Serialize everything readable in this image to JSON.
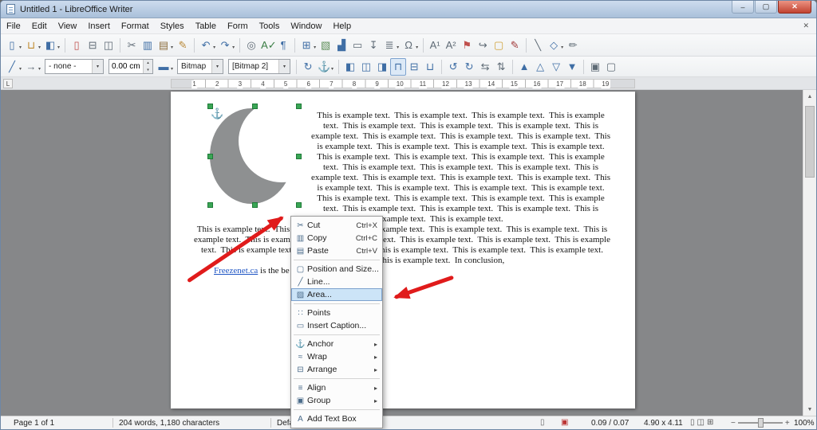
{
  "window": {
    "title": "Untitled 1 - LibreOffice Writer",
    "buttons": [
      {
        "n": "minimize-button",
        "g": "–",
        "cls": "wbtn"
      },
      {
        "n": "maximize-button",
        "g": "▢",
        "cls": "wbtn"
      },
      {
        "n": "close-button",
        "g": "✕",
        "cls": "wbtn close"
      }
    ]
  },
  "menubar": {
    "items": [
      {
        "n": "menu-file",
        "l": "File"
      },
      {
        "n": "menu-edit",
        "l": "Edit"
      },
      {
        "n": "menu-view",
        "l": "View"
      },
      {
        "n": "menu-insert",
        "l": "Insert"
      },
      {
        "n": "menu-format",
        "l": "Format"
      },
      {
        "n": "menu-styles",
        "l": "Styles"
      },
      {
        "n": "menu-table",
        "l": "Table"
      },
      {
        "n": "menu-form",
        "l": "Form"
      },
      {
        "n": "menu-tools",
        "l": "Tools"
      },
      {
        "n": "menu-window",
        "l": "Window"
      },
      {
        "n": "menu-help",
        "l": "Help"
      }
    ],
    "close_glyph": "✕"
  },
  "toolbar_main": {
    "items": [
      {
        "n": "new-document-button",
        "ic": "new-document-icon",
        "g": "▯",
        "c": "#3f6ea5",
        "dd": true
      },
      {
        "n": "open-button",
        "ic": "open-folder-icon",
        "g": "⊔",
        "c": "#c08a2e",
        "dd": true
      },
      {
        "n": "save-button",
        "ic": "save-icon",
        "g": "◧",
        "c": "#3f6ea5",
        "dd": true
      },
      {
        "sep": true
      },
      {
        "n": "export-pdf-button",
        "ic": "pdf-icon",
        "g": "▯",
        "c": "#c0504d"
      },
      {
        "n": "print-button",
        "ic": "printer-icon",
        "g": "⊟",
        "c": "#5f6b76"
      },
      {
        "n": "print-preview-button",
        "ic": "print-preview-icon",
        "g": "◫",
        "c": "#5f6b76"
      },
      {
        "sep": true
      },
      {
        "n": "cut-button",
        "ic": "cut-icon",
        "g": "✂",
        "c": "#5f6b76"
      },
      {
        "n": "copy-button",
        "ic": "copy-icon",
        "g": "▥",
        "c": "#3f6ea5"
      },
      {
        "n": "paste-button",
        "ic": "paste-icon",
        "g": "▤",
        "c": "#8d6e3f",
        "dd": true
      },
      {
        "n": "clone-formatting-button",
        "ic": "clone-formatting-icon",
        "g": "✎",
        "c": "#b98a3a"
      },
      {
        "sep": true
      },
      {
        "n": "undo-button",
        "ic": "undo-icon",
        "g": "↶",
        "c": "#3f6ea5",
        "dd": true
      },
      {
        "n": "redo-button",
        "ic": "redo-icon",
        "g": "↷",
        "c": "#3f6ea5",
        "dd": true
      },
      {
        "sep": true
      },
      {
        "n": "find-replace-button",
        "ic": "find-replace-icon",
        "g": "◎",
        "c": "#5f6b76"
      },
      {
        "n": "spelling-button",
        "ic": "spelling-check-icon",
        "g": "A✓",
        "c": "#3a7d44"
      },
      {
        "n": "formatting-marks-button",
        "ic": "pilcrow-icon",
        "g": "¶",
        "c": "#3f6ea5"
      },
      {
        "sep": true
      },
      {
        "n": "insert-table-button",
        "ic": "table-icon",
        "g": "⊞",
        "c": "#3f6ea5",
        "dd": true
      },
      {
        "n": "insert-image-button",
        "ic": "image-icon",
        "g": "▧",
        "c": "#5f8f5a"
      },
      {
        "n": "insert-chart-button",
        "ic": "chart-icon",
        "g": "▟",
        "c": "#3f6ea5"
      },
      {
        "n": "insert-text-box-button",
        "ic": "text-box-icon",
        "g": "▭",
        "c": "#5f6b76"
      },
      {
        "n": "page-break-button",
        "ic": "page-break-icon",
        "g": "↧",
        "c": "#5f6b76"
      },
      {
        "n": "insert-field-button",
        "ic": "field-icon",
        "g": "≣",
        "c": "#5f6b76",
        "dd": true
      },
      {
        "n": "special-character-button",
        "ic": "omega-icon",
        "g": "Ω",
        "c": "#5f6b76",
        "dd": true
      },
      {
        "sep": true
      },
      {
        "n": "insert-footnote-button",
        "ic": "footnote-icon",
        "g": "A¹",
        "c": "#5f6b76"
      },
      {
        "n": "insert-endnote-button",
        "ic": "endnote-icon",
        "g": "A²",
        "c": "#5f6b76"
      },
      {
        "n": "insert-bookmark-button",
        "ic": "bookmark-icon",
        "g": "⚑",
        "c": "#c0504d"
      },
      {
        "n": "cross-reference-button",
        "ic": "cross-reference-icon",
        "g": "↪",
        "c": "#5f6b76"
      },
      {
        "n": "insert-comment-button",
        "ic": "comment-icon",
        "g": "▢",
        "c": "#d1a33c"
      },
      {
        "n": "track-changes-button",
        "ic": "track-changes-icon",
        "g": "✎",
        "c": "#a33d3d"
      },
      {
        "sep": true
      },
      {
        "n": "insert-line-button",
        "ic": "line-icon",
        "g": "╲",
        "c": "#5f6b76"
      },
      {
        "n": "basic-shapes-button",
        "ic": "shapes-icon",
        "g": "◇",
        "c": "#3f6ea5",
        "dd": true
      },
      {
        "n": "show-draw-functions-button",
        "ic": "draw-functions-icon",
        "g": "✏",
        "c": "#5f6b76"
      }
    ]
  },
  "toolbar_object": {
    "lead_icons": [
      {
        "n": "line-style-button",
        "ic": "line-icon",
        "g": "╱",
        "c": "#3f6ea5",
        "dd": true
      },
      {
        "n": "arrow-style-button",
        "ic": "arrow-style-icon",
        "g": "→",
        "c": "#5f6b76",
        "dd": true
      }
    ],
    "line_style": "- none -",
    "line_width": "0.00 cm",
    "mid_icons": [
      {
        "n": "line-color-button",
        "ic": "line-color-icon",
        "g": "▬",
        "c": "#3f6ea5",
        "dd": true
      }
    ],
    "fill_type": "Bitmap",
    "fill_name": "[Bitmap 2]",
    "tail_icons": [
      {
        "sep": true
      },
      {
        "n": "rotate-button",
        "ic": "rotate-icon",
        "g": "↻",
        "c": "#3f6ea5"
      },
      {
        "n": "anchor-button",
        "ic": "anchor-icon",
        "g": "⚓",
        "c": "#5f6b76",
        "dd": true
      },
      {
        "sep": true
      },
      {
        "n": "align-left-button",
        "ic": "align-left-icon",
        "g": "◧",
        "c": "#3f6ea5"
      },
      {
        "n": "align-center-button",
        "ic": "align-center-icon",
        "g": "◫",
        "c": "#3f6ea5"
      },
      {
        "n": "align-right-button",
        "ic": "align-right-icon",
        "g": "◨",
        "c": "#3f6ea5"
      },
      {
        "n": "align-top-button",
        "ic": "align-top-icon",
        "g": "⊓",
        "c": "#3f6ea5",
        "act": true
      },
      {
        "n": "align-middle-button",
        "ic": "align-middle-icon",
        "g": "⊟",
        "c": "#3f6ea5"
      },
      {
        "n": "align-bottom-button",
        "ic": "align-bottom-icon",
        "g": "⊔",
        "c": "#3f6ea5"
      },
      {
        "sep": true
      },
      {
        "n": "rotate-left-button",
        "ic": "rotate-left-icon",
        "g": "↺",
        "c": "#3f6ea5"
      },
      {
        "n": "rotate-right-button",
        "ic": "rotate-right-icon",
        "g": "↻",
        "c": "#3f6ea5"
      },
      {
        "n": "flip-horizontal-button",
        "ic": "flip-horizontal-icon",
        "g": "⇆",
        "c": "#5f6b76"
      },
      {
        "n": "flip-vertical-button",
        "ic": "flip-vertical-icon",
        "g": "⇅",
        "c": "#5f6b76"
      },
      {
        "sep": true
      },
      {
        "n": "bring-to-front-button",
        "ic": "bring-to-front-icon",
        "g": "▲",
        "c": "#3f6ea5"
      },
      {
        "n": "bring-forward-button",
        "ic": "bring-forward-icon",
        "g": "△",
        "c": "#3f6ea5"
      },
      {
        "n": "send-backward-button",
        "ic": "send-backward-icon",
        "g": "▽",
        "c": "#3f6ea5"
      },
      {
        "n": "send-to-back-button",
        "ic": "send-to-back-icon",
        "g": "▼",
        "c": "#3f6ea5"
      },
      {
        "sep": true
      },
      {
        "n": "group-button",
        "ic": "group-icon",
        "g": "▣",
        "c": "#5f6b76"
      },
      {
        "n": "ungroup-button",
        "ic": "ungroup-icon",
        "g": "▢",
        "c": "#5f6b76"
      }
    ]
  },
  "ruler": {
    "tab_glyph": "L",
    "numbers": [
      "1",
      "2",
      "3",
      "4",
      "5",
      "6",
      "7",
      "8",
      "9",
      "10",
      "11",
      "12",
      "13",
      "14",
      "15",
      "16",
      "17",
      "18",
      "19"
    ]
  },
  "document": {
    "anchor_glyph": "⚓",
    "para1": "This is example text.  This is example text.  This is example text.  This is example text.  This is example text.  This is example text.  This is example text.  This is example text.  This is example text.  This is example text.  This is example text.  This is example text.  This is example text.  This is example text.  This is example text.  This is example text.  This is example text.  This is example text.  This is example text.  This is example text.  This is example text.  This is example text.  This is example text.  This is example text.  This is example text.  This is example text.  This is example text.  This is example text.  This is example text.  This is example text.  This is example text.  This is example text.  This is example text.  This is example text.  This is example text.  This is example text.  This is example text.  This is example text.  This is example text.  This is example text.",
    "para2": "This is example text.  This is example text.  This is example text.  This is example text.  This is example text.  This is example text.  This is example text.  This is example text.  This is example text.  This is example text.  This is example text.  This is example text.  This is example text.  This is example text.  This is example text.  This is example text.  This is example text.  This is example text.  In conclusion,",
    "link_text": "Freezenet.ca",
    "after_link": " is the be"
  },
  "context_menu": {
    "items": [
      {
        "n": "context-menu-item-cut",
        "ic": "cut-icon",
        "i": "✂",
        "l": "Cut",
        "s": "Ctrl+X"
      },
      {
        "n": "context-menu-item-copy",
        "ic": "copy-icon",
        "i": "▥",
        "l": "Copy",
        "s": "Ctrl+C"
      },
      {
        "n": "context-menu-item-paste",
        "ic": "paste-icon",
        "i": "▤",
        "l": "Paste",
        "s": "Ctrl+V"
      },
      {
        "sep": true
      },
      {
        "n": "context-menu-item-position-and-size",
        "ic": "position-size-icon",
        "i": "▢",
        "l": "Position and Size..."
      },
      {
        "n": "context-menu-item-line",
        "ic": "line-icon",
        "i": "╱",
        "l": "Line..."
      },
      {
        "n": "context-menu-item-area",
        "ic": "area-icon",
        "i": "▨",
        "l": "Area...",
        "hl": true
      },
      {
        "sep": true
      },
      {
        "n": "context-menu-item-points",
        "ic": "points-icon",
        "i": "∷",
        "l": "Points"
      },
      {
        "n": "context-menu-item-insert-caption",
        "ic": "caption-icon",
        "i": "▭",
        "l": "Insert Caption..."
      },
      {
        "sep": true
      },
      {
        "n": "context-menu-item-anchor",
        "ic": "anchor-icon",
        "i": "⚓",
        "l": "Anchor",
        "a": "▸"
      },
      {
        "n": "context-menu-item-wrap",
        "ic": "wrap-icon",
        "i": "≈",
        "l": "Wrap",
        "a": "▸"
      },
      {
        "n": "context-menu-item-arrange",
        "ic": "arrange-icon",
        "i": "⊟",
        "l": "Arrange",
        "a": "▸"
      },
      {
        "sep": true
      },
      {
        "n": "context-menu-item-align",
        "ic": "align-icon",
        "i": "≡",
        "l": "Align",
        "a": "▸"
      },
      {
        "n": "context-menu-item-group",
        "ic": "group-icon",
        "i": "▣",
        "l": "Group",
        "a": "▸"
      },
      {
        "sep": true
      },
      {
        "n": "context-menu-item-add-text-box",
        "ic": "text-box-icon",
        "i": "A",
        "l": "Add Text Box"
      }
    ]
  },
  "statusbar": {
    "page_count": "Page 1 of 1",
    "word_count": "204 words, 1,180 characters",
    "page_style": "Default Style",
    "sel_mode_glyph": "▯",
    "modified_glyph": "▣",
    "object_position": "0.09 / 0.07",
    "object_size": "4.90 x 4.11",
    "view_icons": [
      {
        "n": "single-page-view-icon",
        "g": "▯"
      },
      {
        "n": "multi-page-view-icon",
        "g": "◫"
      },
      {
        "n": "book-view-icon",
        "g": "⊞"
      }
    ],
    "zoom_out": "−",
    "zoom_in": "+",
    "zoom_level": "100%"
  },
  "colors": {
    "accent_blue": "#3f6ea5",
    "selection_highlight": "#cce4f7",
    "handle_green": "#3aa655",
    "arrow_red": "#e01b1b",
    "link_blue": "#1f55c4",
    "crescent_gray": "#8e9091"
  }
}
